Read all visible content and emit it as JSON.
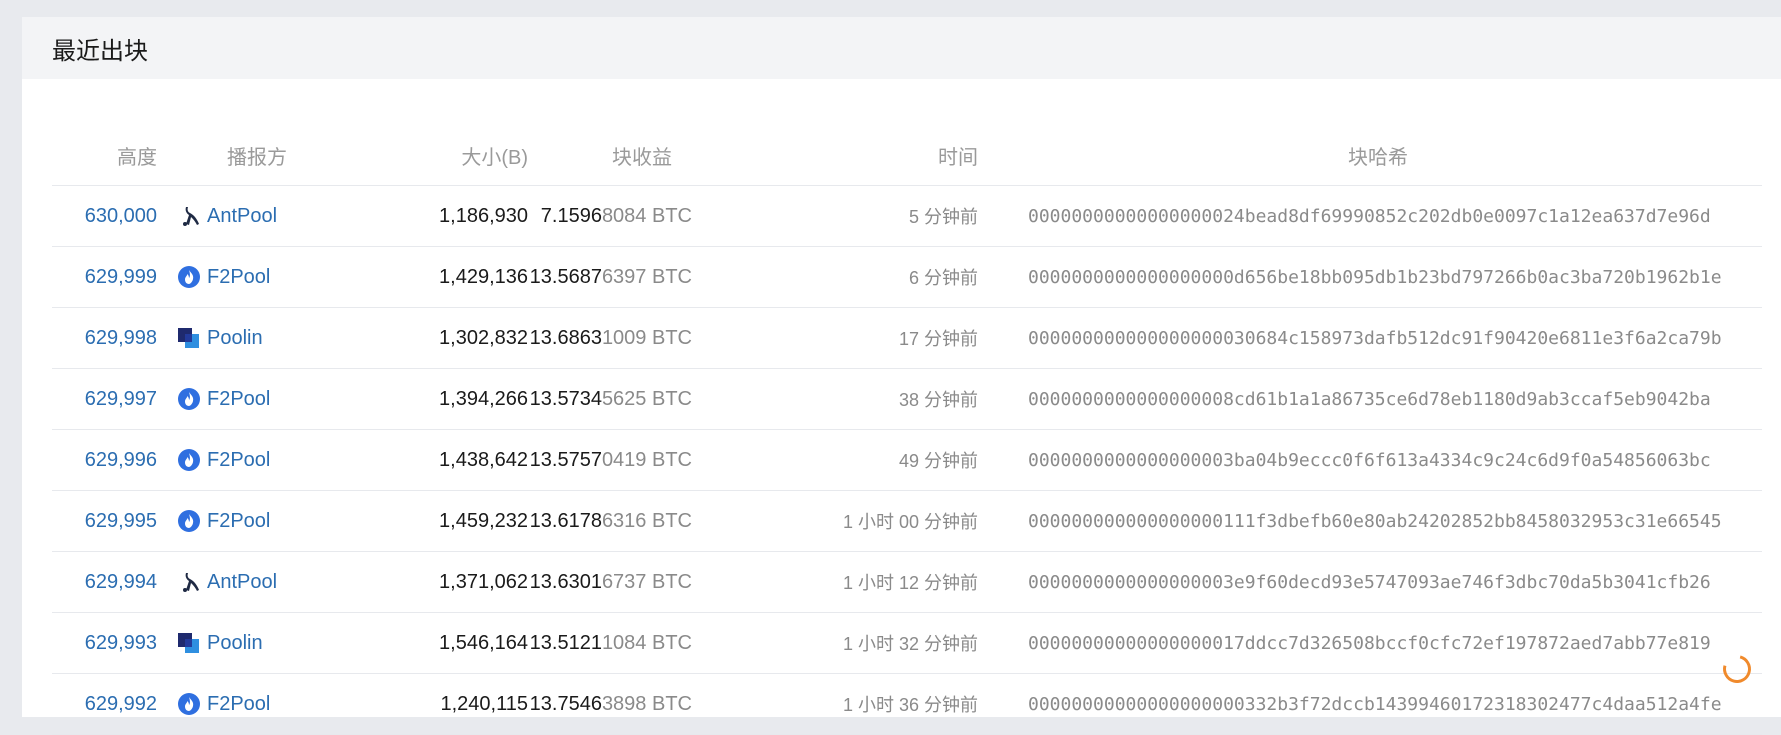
{
  "panel": {
    "title": "最近出块"
  },
  "table": {
    "headers": {
      "height": "高度",
      "pool": "播报方",
      "size": "大小(B)",
      "reward": "块收益",
      "time": "时间",
      "hash": "块哈希"
    },
    "rows": [
      {
        "height": "630,000",
        "pool": "AntPool",
        "pool_icon": "antpool-icon",
        "size": "1,186,930",
        "reward_main": "7.1596",
        "reward_rest": "8084 BTC",
        "time": "5 分钟前",
        "hash": "00000000000000000024bead8df69990852c202db0e0097c1a12ea637d7e96d"
      },
      {
        "height": "629,999",
        "pool": "F2Pool",
        "pool_icon": "f2pool-icon",
        "size": "1,429,136",
        "reward_main": "13.5687",
        "reward_rest": "6397 BTC",
        "time": "6 分钟前",
        "hash": "0000000000000000000d656be18bb095db1b23bd797266b0ac3ba720b1962b1e"
      },
      {
        "height": "629,998",
        "pool": "Poolin",
        "pool_icon": "poolin-icon",
        "size": "1,302,832",
        "reward_main": "13.6863",
        "reward_rest": "1009 BTC",
        "time": "17 分钟前",
        "hash": "000000000000000000030684c158973dafb512dc91f90420e6811e3f6a2ca79b"
      },
      {
        "height": "629,997",
        "pool": "F2Pool",
        "pool_icon": "f2pool-icon",
        "size": "1,394,266",
        "reward_main": "13.5734",
        "reward_rest": "5625 BTC",
        "time": "38 分钟前",
        "hash": "0000000000000000008cd61b1a1a86735ce6d78eb1180d9ab3ccaf5eb9042ba"
      },
      {
        "height": "629,996",
        "pool": "F2Pool",
        "pool_icon": "f2pool-icon",
        "size": "1,438,642",
        "reward_main": "13.5757",
        "reward_rest": "0419 BTC",
        "time": "49 分钟前",
        "hash": "0000000000000000003ba04b9eccc0f6f613a4334c9c24c6d9f0a54856063bc"
      },
      {
        "height": "629,995",
        "pool": "F2Pool",
        "pool_icon": "f2pool-icon",
        "size": "1,459,232",
        "reward_main": "13.6178",
        "reward_rest": "6316 BTC",
        "time": "1 小时 00 分钟前",
        "hash": "000000000000000000111f3dbefb60e80ab24202852bb8458032953c31e66545"
      },
      {
        "height": "629,994",
        "pool": "AntPool",
        "pool_icon": "antpool-icon",
        "size": "1,371,062",
        "reward_main": "13.6301",
        "reward_rest": "6737 BTC",
        "time": "1 小时 12 分钟前",
        "hash": "0000000000000000003e9f60decd93e5747093ae746f3dbc70da5b3041cfb26"
      },
      {
        "height": "629,993",
        "pool": "Poolin",
        "pool_icon": "poolin-icon",
        "size": "1,546,164",
        "reward_main": "13.5121",
        "reward_rest": "1084 BTC",
        "time": "1 小时 32 分钟前",
        "hash": "00000000000000000017ddcc7d326508bccf0cfc72ef197872aed7abb77e819"
      },
      {
        "height": "629,992",
        "pool": "F2Pool",
        "pool_icon": "f2pool-icon",
        "size": "1,240,115",
        "reward_main": "13.7546",
        "reward_rest": "3898 BTC",
        "time": "1 小时 36 分钟前",
        "hash": "00000000000000000000332b3f72dccb14399460172318302477c4daa512a4fe"
      }
    ]
  },
  "colors": {
    "link": "#2b6db1",
    "muted": "#8a8a8a",
    "header_bg": "#f3f4f6",
    "page_bg": "#e8eaee",
    "spinner": "#f08a2c"
  }
}
